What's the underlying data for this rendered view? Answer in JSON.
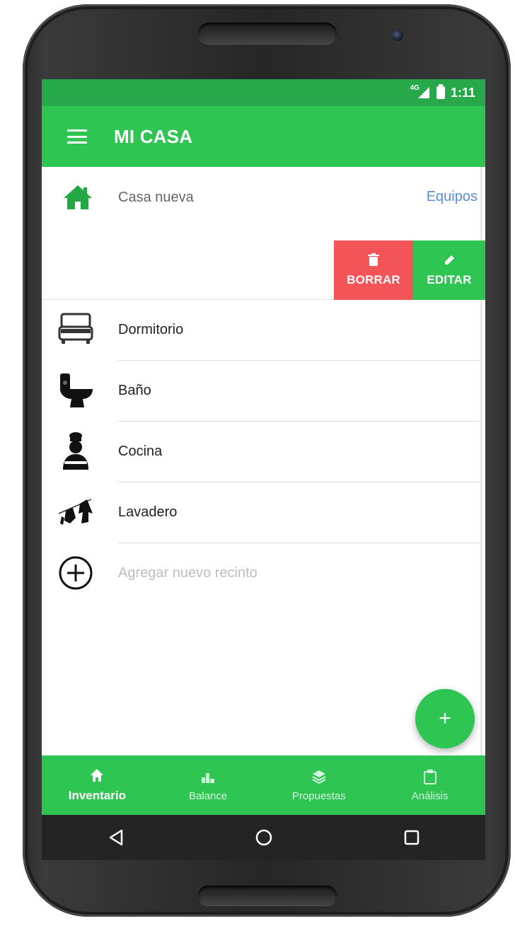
{
  "status_bar": {
    "network": "4G",
    "time": "1:11"
  },
  "app_bar": {
    "title": "MI CASA"
  },
  "house": {
    "name": "Casa nueva",
    "link_label": "Equipos"
  },
  "actions": {
    "delete_label": "BORRAR",
    "edit_label": "EDITAR"
  },
  "rooms": [
    {
      "label": "Dormitorio",
      "icon": "bed-icon"
    },
    {
      "label": "Baño",
      "icon": "toilet-icon"
    },
    {
      "label": "Cocina",
      "icon": "chef-icon"
    },
    {
      "label": "Lavadero",
      "icon": "laundry-icon"
    }
  ],
  "add_room": {
    "placeholder": "Agregar nuevo recinto",
    "icon": "add-circle-icon"
  },
  "fab": {
    "label": "+"
  },
  "bottom_nav": [
    {
      "label": "Inventario",
      "icon": "home-icon",
      "active": true
    },
    {
      "label": "Balance",
      "icon": "bar-chart-icon",
      "active": false
    },
    {
      "label": "Propuestas",
      "icon": "layers-icon",
      "active": false
    },
    {
      "label": "Análisis",
      "icon": "clipboard-icon",
      "active": false
    }
  ],
  "colors": {
    "primary": "#2ec553",
    "status": "#27a84a",
    "danger": "#f25458",
    "link": "#5b8dd6"
  }
}
